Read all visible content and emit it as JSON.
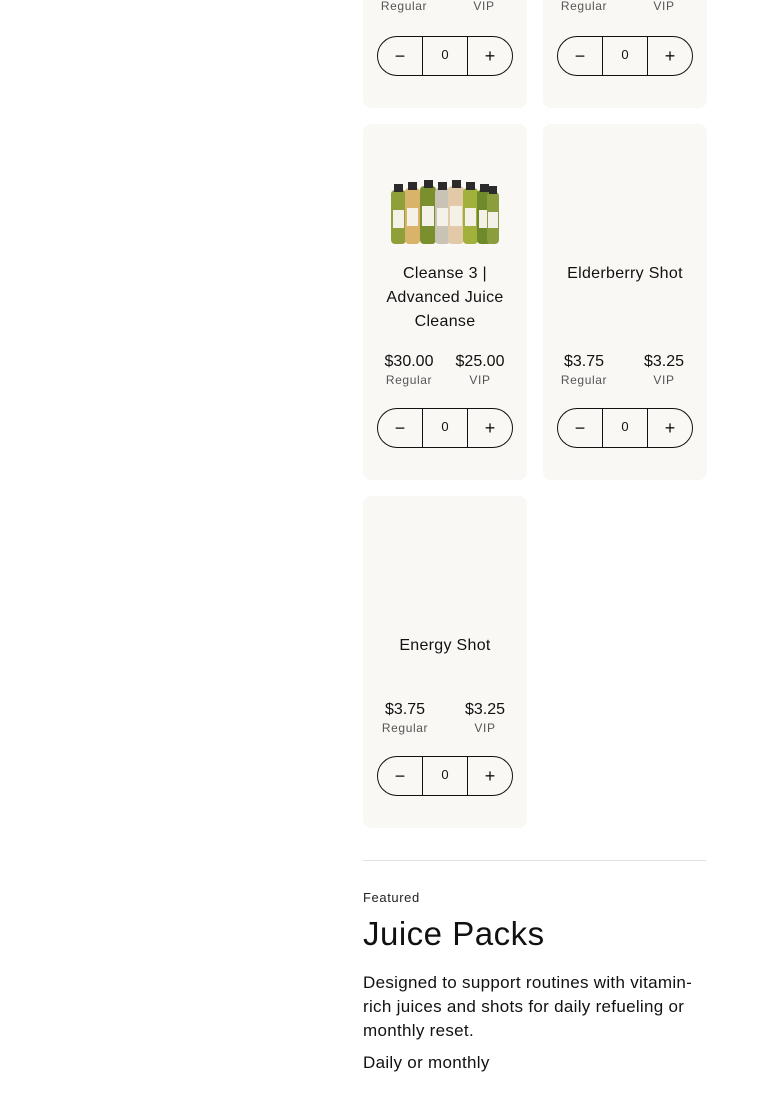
{
  "products": [
    {
      "name": "",
      "regular_price": "",
      "regular_label": "Regular",
      "vip_price": "",
      "vip_label": "VIP",
      "qty": "0",
      "image": ""
    },
    {
      "name": "",
      "regular_price": "",
      "regular_label": "Regular",
      "vip_price": "",
      "vip_label": "VIP",
      "qty": "0",
      "image": ""
    },
    {
      "name": "Cleanse 3 | Advanced Juice Cleanse",
      "regular_price": "$30.00",
      "regular_label": "Regular",
      "vip_price": "$25.00",
      "vip_label": "VIP",
      "qty": "0",
      "image": "juice-bottles"
    },
    {
      "name": "Elderberry Shot",
      "regular_price": "$3.75",
      "regular_label": "Regular",
      "vip_price": "$3.25",
      "vip_label": "VIP",
      "qty": "0",
      "image": ""
    },
    {
      "name": "Energy Shot",
      "regular_price": "$3.75",
      "regular_label": "Regular",
      "vip_price": "$3.25",
      "vip_label": "VIP",
      "qty": "0",
      "image": ""
    }
  ],
  "stepper": {
    "minus_icon": "minus-icon",
    "plus_icon": "plus-icon"
  },
  "featured": {
    "eyebrow": "Featured",
    "title": "Juice Packs",
    "description": "Designed to support routines with vitamin-rich juices and shots for daily refueling or monthly reset.",
    "subtitle": "Daily or monthly"
  },
  "colors": {
    "card_bg": "#faf8f4",
    "text": "#111111",
    "divider": "#e3e0da"
  }
}
